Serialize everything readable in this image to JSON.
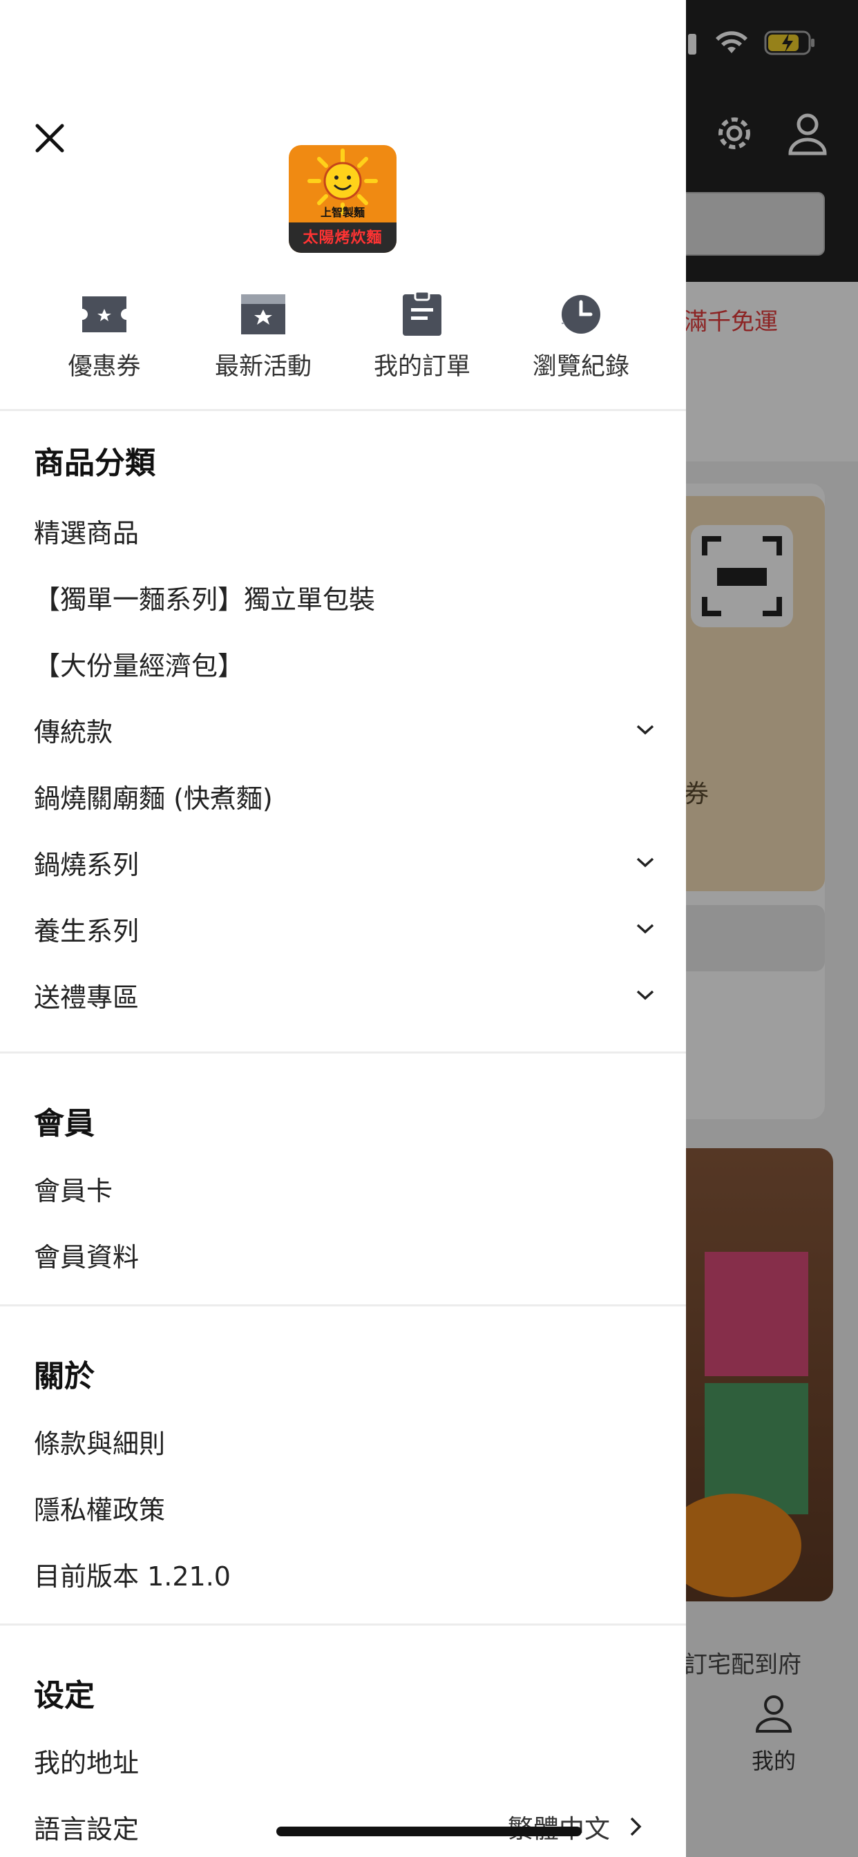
{
  "background": {
    "promo_text": "滿千免運",
    "coupon_text": "券",
    "delivery_text": "訂宅配到府",
    "tab_label": "我的"
  },
  "drawer": {
    "logo": {
      "top_text": "上智製麵",
      "bottom_text": "太陽烤炊麵"
    },
    "quick_actions": [
      {
        "label": "優惠券",
        "icon": "ticket-icon"
      },
      {
        "label": "最新活動",
        "icon": "star-tag-icon"
      },
      {
        "label": "我的訂單",
        "icon": "clipboard-icon"
      },
      {
        "label": "瀏覽紀錄",
        "icon": "clock-icon"
      }
    ],
    "categories": {
      "title": "商品分類",
      "items": [
        {
          "label": "精選商品",
          "expandable": false
        },
        {
          "label": "【獨單一麵系列】獨立單包裝",
          "expandable": false
        },
        {
          "label": "【大份量經濟包】",
          "expandable": false
        },
        {
          "label": "傳統款",
          "expandable": true
        },
        {
          "label": "鍋燒關廟麵 (快煮麵)",
          "expandable": false
        },
        {
          "label": "鍋燒系列",
          "expandable": true
        },
        {
          "label": "養生系列",
          "expandable": true
        },
        {
          "label": "送禮專區",
          "expandable": true
        }
      ]
    },
    "member": {
      "title": "會員",
      "items": [
        {
          "label": "會員卡"
        },
        {
          "label": "會員資料"
        }
      ]
    },
    "about": {
      "title": "關於",
      "items": [
        {
          "label": "條款與細則"
        },
        {
          "label": "隱私權政策"
        },
        {
          "label": "目前版本 1.21.0"
        }
      ]
    },
    "settings": {
      "title": "设定",
      "items": [
        {
          "label": "我的地址"
        },
        {
          "label": "語言設定",
          "value": "繁體中文"
        }
      ]
    }
  },
  "colors": {
    "brand_orange": "#f08a12",
    "promo_red": "#e23a3a",
    "icon_gray": "#4a4f5a"
  }
}
